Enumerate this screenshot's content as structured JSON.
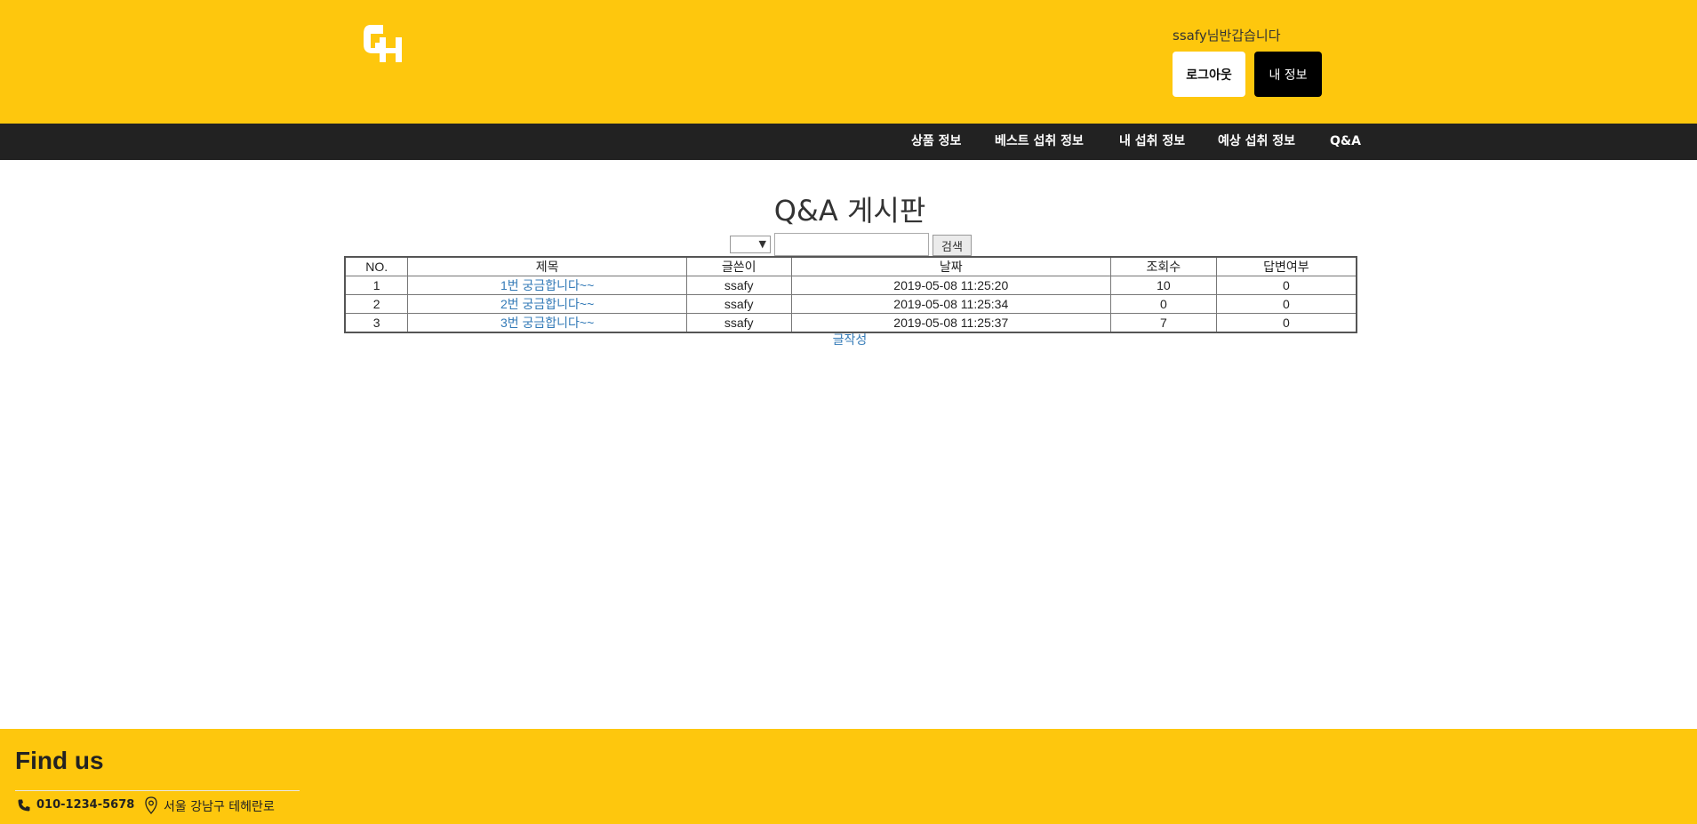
{
  "header": {
    "logo_text": "GH",
    "greeting": "ssafy님반갑습니다",
    "logout_label": "로그아웃",
    "myinfo_label": "내 정보"
  },
  "nav": {
    "items": [
      {
        "label": "상품 정보"
      },
      {
        "label": "베스트 섭취 정보"
      },
      {
        "label": "내 섭취 정보"
      },
      {
        "label": "예상 섭취 정보"
      },
      {
        "label": "Q&A"
      }
    ]
  },
  "board": {
    "title": "Q&A 게시판",
    "search_button": "검색",
    "columns": [
      "NO.",
      "제목",
      "글쓴이",
      "날짜",
      "조회수",
      "답변여부"
    ],
    "rows": [
      {
        "no": "1",
        "title": "1번 궁금합니다~~",
        "author": "ssafy",
        "date": "2019-05-08 11:25:20",
        "views": "10",
        "answered": "0"
      },
      {
        "no": "2",
        "title": "2번 궁금합니다~~",
        "author": "ssafy",
        "date": "2019-05-08 11:25:34",
        "views": "0",
        "answered": "0"
      },
      {
        "no": "3",
        "title": "3번 궁금합니다~~",
        "author": "ssafy",
        "date": "2019-05-08 11:25:37",
        "views": "7",
        "answered": "0"
      }
    ],
    "write_label": "글작성"
  },
  "footer": {
    "heading": "Find us",
    "phone": "010-1234-5678",
    "address": "서울 강남구 테헤란로"
  },
  "colors": {
    "brand_yellow": "#fec70d",
    "nav_dark": "#222222",
    "link_blue": "#337ab7"
  },
  "icons": {
    "phone": "phone-icon",
    "location": "map-pin-icon",
    "dropdown": "chevron-down-icon"
  }
}
